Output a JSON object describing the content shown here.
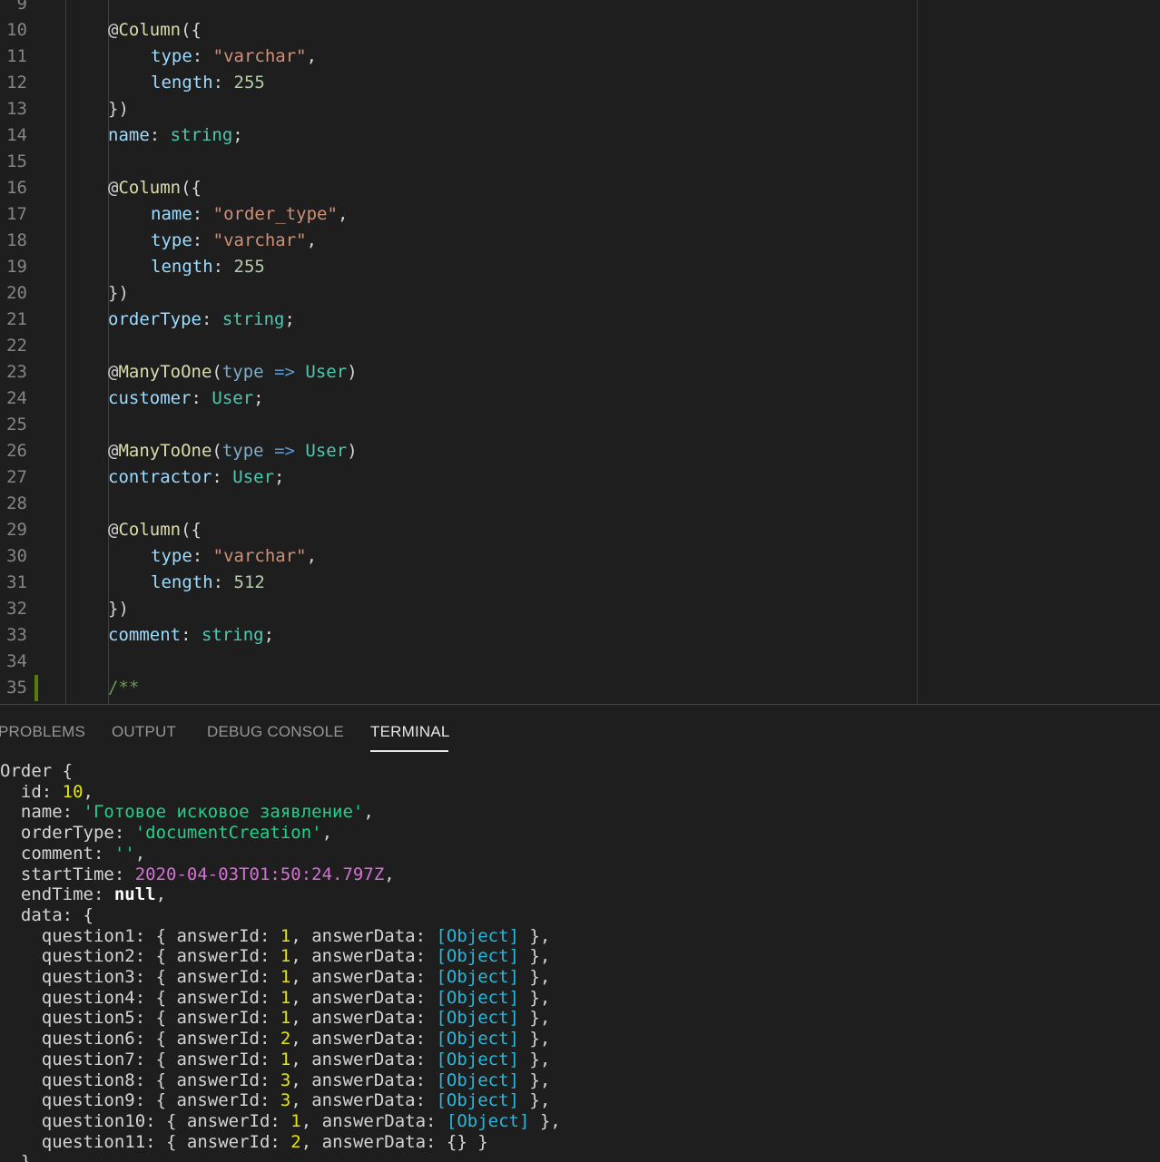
{
  "editor": {
    "lines": [
      {
        "n": "9",
        "tokens": []
      },
      {
        "n": "10",
        "indent": 1,
        "tokens": [
          [
            "at",
            "@"
          ],
          [
            "dec",
            "Column"
          ],
          [
            "punc",
            "({"
          ]
        ]
      },
      {
        "n": "11",
        "indent": 2,
        "tokens": [
          [
            "prop",
            "type"
          ],
          [
            "punc",
            ": "
          ],
          [
            "str",
            "\"varchar\""
          ],
          [
            "punc",
            ","
          ]
        ]
      },
      {
        "n": "12",
        "indent": 2,
        "tokens": [
          [
            "prop",
            "length"
          ],
          [
            "punc",
            ": "
          ],
          [
            "num",
            "255"
          ]
        ]
      },
      {
        "n": "13",
        "indent": 1,
        "tokens": [
          [
            "punc",
            "})"
          ]
        ]
      },
      {
        "n": "14",
        "indent": 1,
        "tokens": [
          [
            "prop",
            "name"
          ],
          [
            "punc",
            ": "
          ],
          [
            "type",
            "string"
          ],
          [
            "punc",
            ";"
          ]
        ]
      },
      {
        "n": "15",
        "indent": 1,
        "tokens": []
      },
      {
        "n": "16",
        "indent": 1,
        "tokens": [
          [
            "at",
            "@"
          ],
          [
            "dec",
            "Column"
          ],
          [
            "punc",
            "({"
          ]
        ]
      },
      {
        "n": "17",
        "indent": 2,
        "tokens": [
          [
            "prop",
            "name"
          ],
          [
            "punc",
            ": "
          ],
          [
            "str",
            "\"order_type\""
          ],
          [
            "punc",
            ","
          ]
        ]
      },
      {
        "n": "18",
        "indent": 2,
        "tokens": [
          [
            "prop",
            "type"
          ],
          [
            "punc",
            ": "
          ],
          [
            "str",
            "\"varchar\""
          ],
          [
            "punc",
            ","
          ]
        ]
      },
      {
        "n": "19",
        "indent": 2,
        "tokens": [
          [
            "prop",
            "length"
          ],
          [
            "punc",
            ": "
          ],
          [
            "num",
            "255"
          ]
        ]
      },
      {
        "n": "20",
        "indent": 1,
        "tokens": [
          [
            "punc",
            "})"
          ]
        ]
      },
      {
        "n": "21",
        "indent": 1,
        "tokens": [
          [
            "prop",
            "orderType"
          ],
          [
            "punc",
            ": "
          ],
          [
            "type",
            "string"
          ],
          [
            "punc",
            ";"
          ]
        ]
      },
      {
        "n": "22",
        "indent": 1,
        "tokens": []
      },
      {
        "n": "23",
        "indent": 1,
        "tokens": [
          [
            "at",
            "@"
          ],
          [
            "dec",
            "ManyToOne"
          ],
          [
            "punc",
            "("
          ],
          [
            "param",
            "type"
          ],
          [
            "punc",
            " "
          ],
          [
            "arrow",
            "=>"
          ],
          [
            "punc",
            " "
          ],
          [
            "type",
            "User"
          ],
          [
            "punc",
            ")"
          ]
        ]
      },
      {
        "n": "24",
        "indent": 1,
        "tokens": [
          [
            "prop",
            "customer"
          ],
          [
            "punc",
            ": "
          ],
          [
            "type",
            "User"
          ],
          [
            "punc",
            ";"
          ]
        ]
      },
      {
        "n": "25",
        "indent": 1,
        "tokens": []
      },
      {
        "n": "26",
        "indent": 1,
        "tokens": [
          [
            "at",
            "@"
          ],
          [
            "dec",
            "ManyToOne"
          ],
          [
            "punc",
            "("
          ],
          [
            "param",
            "type"
          ],
          [
            "punc",
            " "
          ],
          [
            "arrow",
            "=>"
          ],
          [
            "punc",
            " "
          ],
          [
            "type",
            "User"
          ],
          [
            "punc",
            ")"
          ]
        ]
      },
      {
        "n": "27",
        "indent": 1,
        "tokens": [
          [
            "prop",
            "contractor"
          ],
          [
            "punc",
            ": "
          ],
          [
            "type",
            "User"
          ],
          [
            "punc",
            ";"
          ]
        ]
      },
      {
        "n": "28",
        "indent": 1,
        "tokens": []
      },
      {
        "n": "29",
        "indent": 1,
        "tokens": [
          [
            "at",
            "@"
          ],
          [
            "dec",
            "Column"
          ],
          [
            "punc",
            "({"
          ]
        ]
      },
      {
        "n": "30",
        "indent": 2,
        "tokens": [
          [
            "prop",
            "type"
          ],
          [
            "punc",
            ": "
          ],
          [
            "str",
            "\"varchar\""
          ],
          [
            "punc",
            ","
          ]
        ]
      },
      {
        "n": "31",
        "indent": 2,
        "tokens": [
          [
            "prop",
            "length"
          ],
          [
            "punc",
            ": "
          ],
          [
            "num",
            "512"
          ]
        ]
      },
      {
        "n": "32",
        "indent": 1,
        "tokens": [
          [
            "punc",
            "})"
          ]
        ]
      },
      {
        "n": "33",
        "indent": 1,
        "tokens": [
          [
            "prop",
            "comment"
          ],
          [
            "punc",
            ": "
          ],
          [
            "type",
            "string"
          ],
          [
            "punc",
            ";"
          ]
        ]
      },
      {
        "n": "34",
        "indent": 1,
        "tokens": []
      },
      {
        "n": "35",
        "indent": 1,
        "tokens": [
          [
            "com",
            "/**"
          ]
        ]
      }
    ]
  },
  "panel": {
    "tabs": [
      {
        "label": "PROBLEMS",
        "active": false
      },
      {
        "label": "OUTPUT",
        "active": false
      },
      {
        "label": "DEBUG CONSOLE",
        "active": false
      },
      {
        "label": "TERMINAL",
        "active": true
      }
    ]
  },
  "terminal": {
    "lines": [
      [
        [
          "plain",
          "Order {"
        ]
      ],
      [
        [
          "plain",
          "  id: "
        ],
        [
          "num",
          "10"
        ],
        [
          "plain",
          ","
        ]
      ],
      [
        [
          "plain",
          "  name: "
        ],
        [
          "str",
          "'Готовое исковое заявление'"
        ],
        [
          "plain",
          ","
        ]
      ],
      [
        [
          "plain",
          "  orderType: "
        ],
        [
          "str",
          "'documentCreation'"
        ],
        [
          "plain",
          ","
        ]
      ],
      [
        [
          "plain",
          "  comment: "
        ],
        [
          "str",
          "''"
        ],
        [
          "plain",
          ","
        ]
      ],
      [
        [
          "plain",
          "  startTime: "
        ],
        [
          "date",
          "2020-04-03T01:50:24.797Z"
        ],
        [
          "plain",
          ","
        ]
      ],
      [
        [
          "plain",
          "  endTime: "
        ],
        [
          "null",
          "null"
        ],
        [
          "plain",
          ","
        ]
      ],
      [
        [
          "plain",
          "  data: {"
        ]
      ],
      [
        [
          "plain",
          "    question1: { answerId: "
        ],
        [
          "num",
          "1"
        ],
        [
          "plain",
          ", answerData: "
        ],
        [
          "obj",
          "[Object]"
        ],
        [
          "plain",
          " },"
        ]
      ],
      [
        [
          "plain",
          "    question2: { answerId: "
        ],
        [
          "num",
          "1"
        ],
        [
          "plain",
          ", answerData: "
        ],
        [
          "obj",
          "[Object]"
        ],
        [
          "plain",
          " },"
        ]
      ],
      [
        [
          "plain",
          "    question3: { answerId: "
        ],
        [
          "num",
          "1"
        ],
        [
          "plain",
          ", answerData: "
        ],
        [
          "obj",
          "[Object]"
        ],
        [
          "plain",
          " },"
        ]
      ],
      [
        [
          "plain",
          "    question4: { answerId: "
        ],
        [
          "num",
          "1"
        ],
        [
          "plain",
          ", answerData: "
        ],
        [
          "obj",
          "[Object]"
        ],
        [
          "plain",
          " },"
        ]
      ],
      [
        [
          "plain",
          "    question5: { answerId: "
        ],
        [
          "num",
          "1"
        ],
        [
          "plain",
          ", answerData: "
        ],
        [
          "obj",
          "[Object]"
        ],
        [
          "plain",
          " },"
        ]
      ],
      [
        [
          "plain",
          "    question6: { answerId: "
        ],
        [
          "num",
          "2"
        ],
        [
          "plain",
          ", answerData: "
        ],
        [
          "obj",
          "[Object]"
        ],
        [
          "plain",
          " },"
        ]
      ],
      [
        [
          "plain",
          "    question7: { answerId: "
        ],
        [
          "num",
          "1"
        ],
        [
          "plain",
          ", answerData: "
        ],
        [
          "obj",
          "[Object]"
        ],
        [
          "plain",
          " },"
        ]
      ],
      [
        [
          "plain",
          "    question8: { answerId: "
        ],
        [
          "num",
          "3"
        ],
        [
          "plain",
          ", answerData: "
        ],
        [
          "obj",
          "[Object]"
        ],
        [
          "plain",
          " },"
        ]
      ],
      [
        [
          "plain",
          "    question9: { answerId: "
        ],
        [
          "num",
          "3"
        ],
        [
          "plain",
          ", answerData: "
        ],
        [
          "obj",
          "[Object]"
        ],
        [
          "plain",
          " },"
        ]
      ],
      [
        [
          "plain",
          "    question10: { answerId: "
        ],
        [
          "num",
          "1"
        ],
        [
          "plain",
          ", answerData: "
        ],
        [
          "obj",
          "[Object]"
        ],
        [
          "plain",
          " },"
        ]
      ],
      [
        [
          "plain",
          "    question11: { answerId: "
        ],
        [
          "num",
          "2"
        ],
        [
          "plain",
          ", answerData: {} }"
        ]
      ],
      [
        [
          "plain",
          "  }"
        ]
      ]
    ]
  }
}
